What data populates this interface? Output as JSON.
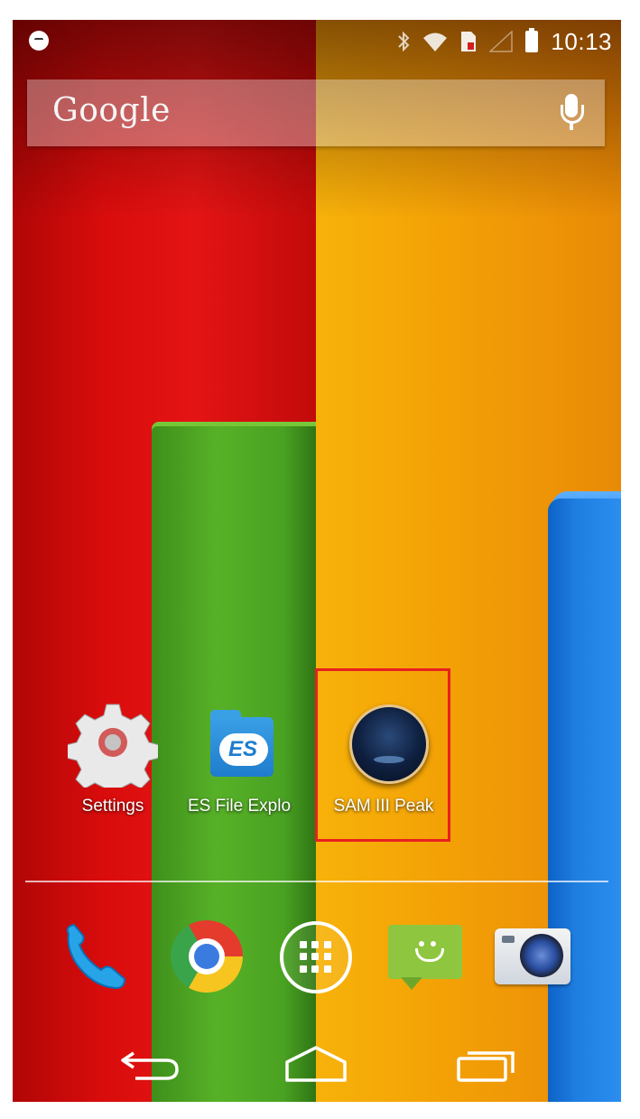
{
  "status_bar": {
    "time": "10:13",
    "icons": [
      "motorola-logo-icon",
      "bluetooth-icon",
      "wifi-icon",
      "sim-card-icon",
      "cell-signal-icon",
      "battery-icon"
    ]
  },
  "search_bar": {
    "logo_text": "Google",
    "icon": "microphone-icon"
  },
  "home_apps": [
    {
      "label": "Settings",
      "icon": "gear-icon"
    },
    {
      "label": "ES File Explo",
      "icon": "es-file-explorer-icon"
    },
    {
      "label": "SAM III Peak",
      "icon": "sam-iii-peak-icon"
    }
  ],
  "dock": [
    {
      "icon": "phone-icon"
    },
    {
      "icon": "chrome-icon"
    },
    {
      "icon": "app-drawer-icon"
    },
    {
      "icon": "messaging-icon"
    },
    {
      "icon": "camera-icon"
    }
  ],
  "nav_bar": [
    "back-icon",
    "home-icon",
    "recent-apps-icon"
  ],
  "colors": {
    "highlight": "#e82020",
    "wallpaper_red": "#d90c0c",
    "wallpaper_orange": "#f4a406",
    "wallpaper_green": "#57b127",
    "wallpaper_blue": "#1f7fe0"
  }
}
